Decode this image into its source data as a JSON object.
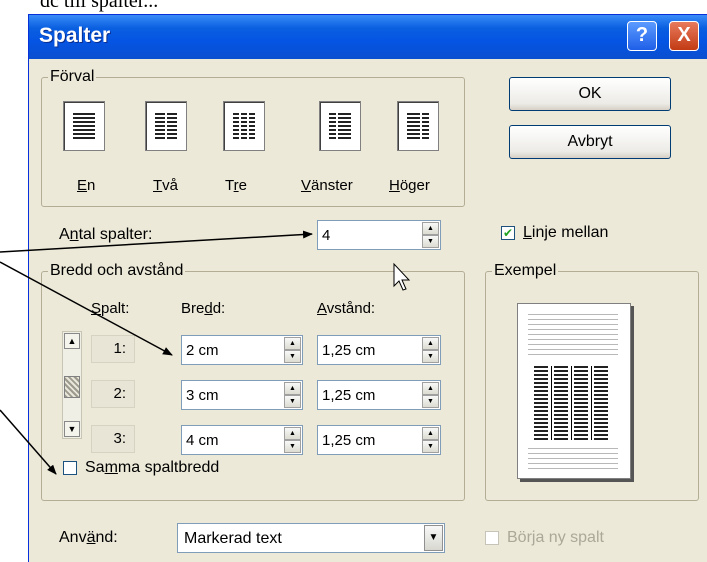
{
  "top_text": "dc till spalter...",
  "dialog": {
    "title": "Spalter",
    "help_btn": "?",
    "close_btn": "X",
    "preset_legend": "Förval",
    "presets": [
      {
        "label_a": "",
        "label_u": "E",
        "label_b": "n"
      },
      {
        "label_a": "",
        "label_u": "T",
        "label_b": "vå"
      },
      {
        "label_a": "T",
        "label_u": "r",
        "label_b": "e"
      },
      {
        "label_a": "",
        "label_u": "V",
        "label_b": "änster"
      },
      {
        "label_a": "",
        "label_u": "H",
        "label_b": "öger"
      }
    ],
    "ok": "OK",
    "cancel": "Avbryt",
    "num_cols_label_a": "A",
    "num_cols_label_u": "n",
    "num_cols_label_b": "tal spalter:",
    "num_cols_value": "4",
    "line_between_checked": "✔",
    "line_between_u": "L",
    "line_between_b": "inje mellan",
    "width_spacing_legend": "Bredd och avstånd",
    "col_header_u": "S",
    "col_header_b": "palt:",
    "width_header_a": "Bre",
    "width_header_u": "d",
    "width_header_b": "d:",
    "spacing_header_u": "A",
    "spacing_header_b": "vstånd:",
    "rows": [
      {
        "col": "1:",
        "width": "2 cm",
        "spacing": "1,25 cm"
      },
      {
        "col": "2:",
        "width": "3 cm",
        "spacing": "1,25 cm"
      },
      {
        "col": "3:",
        "width": "4 cm",
        "spacing": "1,25 cm"
      }
    ],
    "equal_width_a": "Sa",
    "equal_width_u": "m",
    "equal_width_b": "ma spaltbredd",
    "preview_legend": "Exempel",
    "apply_label_a": "Anv",
    "apply_label_u": "ä",
    "apply_label_b": "nd:",
    "apply_value": "Markerad text",
    "new_col": "Börja ny spalt"
  },
  "colors": {
    "title_bar": "#0554e3",
    "dialog_bg": "#ece9d8",
    "arrow": "#000000"
  }
}
